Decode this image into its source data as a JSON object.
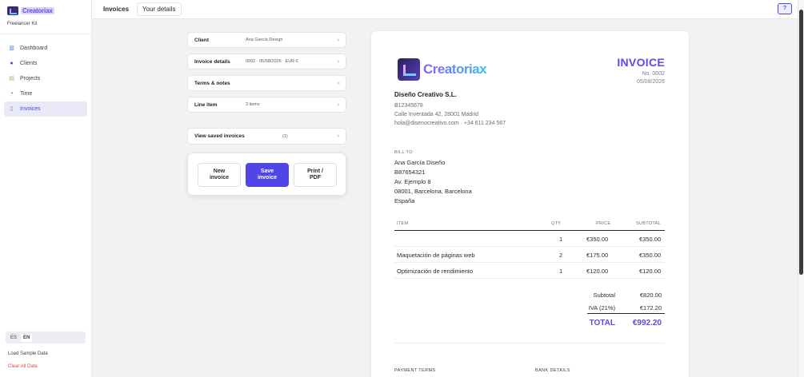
{
  "sidebar": {
    "brand_name": "Creatoriax",
    "subtitle": "Freelancer Kit",
    "items": [
      {
        "label": "Dashboard",
        "icon": "chart-icon"
      },
      {
        "label": "Clients",
        "icon": "people-icon"
      },
      {
        "label": "Projects",
        "icon": "folder-icon"
      },
      {
        "label": "Time",
        "icon": "timer-icon"
      },
      {
        "label": "Invoices",
        "icon": "document-icon",
        "active": true
      }
    ],
    "languages": [
      "ES",
      "EN"
    ],
    "active_language": "EN",
    "load_sample": "Load Sample Data",
    "clear_all": "Clear All Data"
  },
  "topbar": {
    "tabs": [
      "Invoices",
      "Your details"
    ],
    "help_label": "?"
  },
  "editor": {
    "sections": [
      {
        "label": "Client",
        "value": "Ana García Design"
      },
      {
        "label": "Invoice details",
        "value": "0002 · 05/08/2026 · EUR €"
      },
      {
        "label": "Terms & notes",
        "value": ""
      },
      {
        "label": "Line item",
        "value": "3 items"
      }
    ],
    "saved": {
      "label": "View saved invoices",
      "value": "(1)"
    },
    "buttons": {
      "new": "New\ninvoice",
      "save": "Save\ninvoice",
      "print": "Print /\nPDF"
    }
  },
  "invoice": {
    "brand_word": "Creatoriax",
    "title": "INVOICE",
    "number": "No. 0002",
    "date": "05/08/2026",
    "company": {
      "name": "Diseño Creativo S.L.",
      "tax_id": "B12345678",
      "address": "Calle Inventada 42, 28001 Madrid",
      "contact": "hola@disenocreativo.com · +34 611 234 567"
    },
    "bill_to": {
      "heading": "BILL TO",
      "lines": [
        "Ana García Diseño",
        "B87654321",
        "Av. Ejemplo 8",
        "08001, Barcelona, Barcelona",
        "España"
      ]
    },
    "table": {
      "headers": {
        "item": "ITEM",
        "qty": "QTY",
        "price": "PRICE",
        "subtotal": "SUBTOTAL"
      },
      "rows": [
        {
          "item": "",
          "qty": "1",
          "price": "€350.00",
          "subtotal": "€350.00"
        },
        {
          "item": "Maquetación de páginas web",
          "qty": "2",
          "price": "€175.00",
          "subtotal": "€350.00"
        },
        {
          "item": "Optimización de rendimiento",
          "qty": "1",
          "price": "€120.00",
          "subtotal": "€120.00"
        }
      ]
    },
    "totals": {
      "subtotal_label": "Subtotal",
      "subtotal": "€820.00",
      "tax_label": "IVA (21%)",
      "tax": "€172.20",
      "total_label": "TOTAL",
      "total": "€992.20"
    },
    "footer": {
      "payment_terms": "PAYMENT TERMS",
      "bank_details": "BANK DETAILS"
    }
  },
  "colors": {
    "accent": "#4f46e5",
    "title": "#5b4be0",
    "danger": "#e04848"
  }
}
